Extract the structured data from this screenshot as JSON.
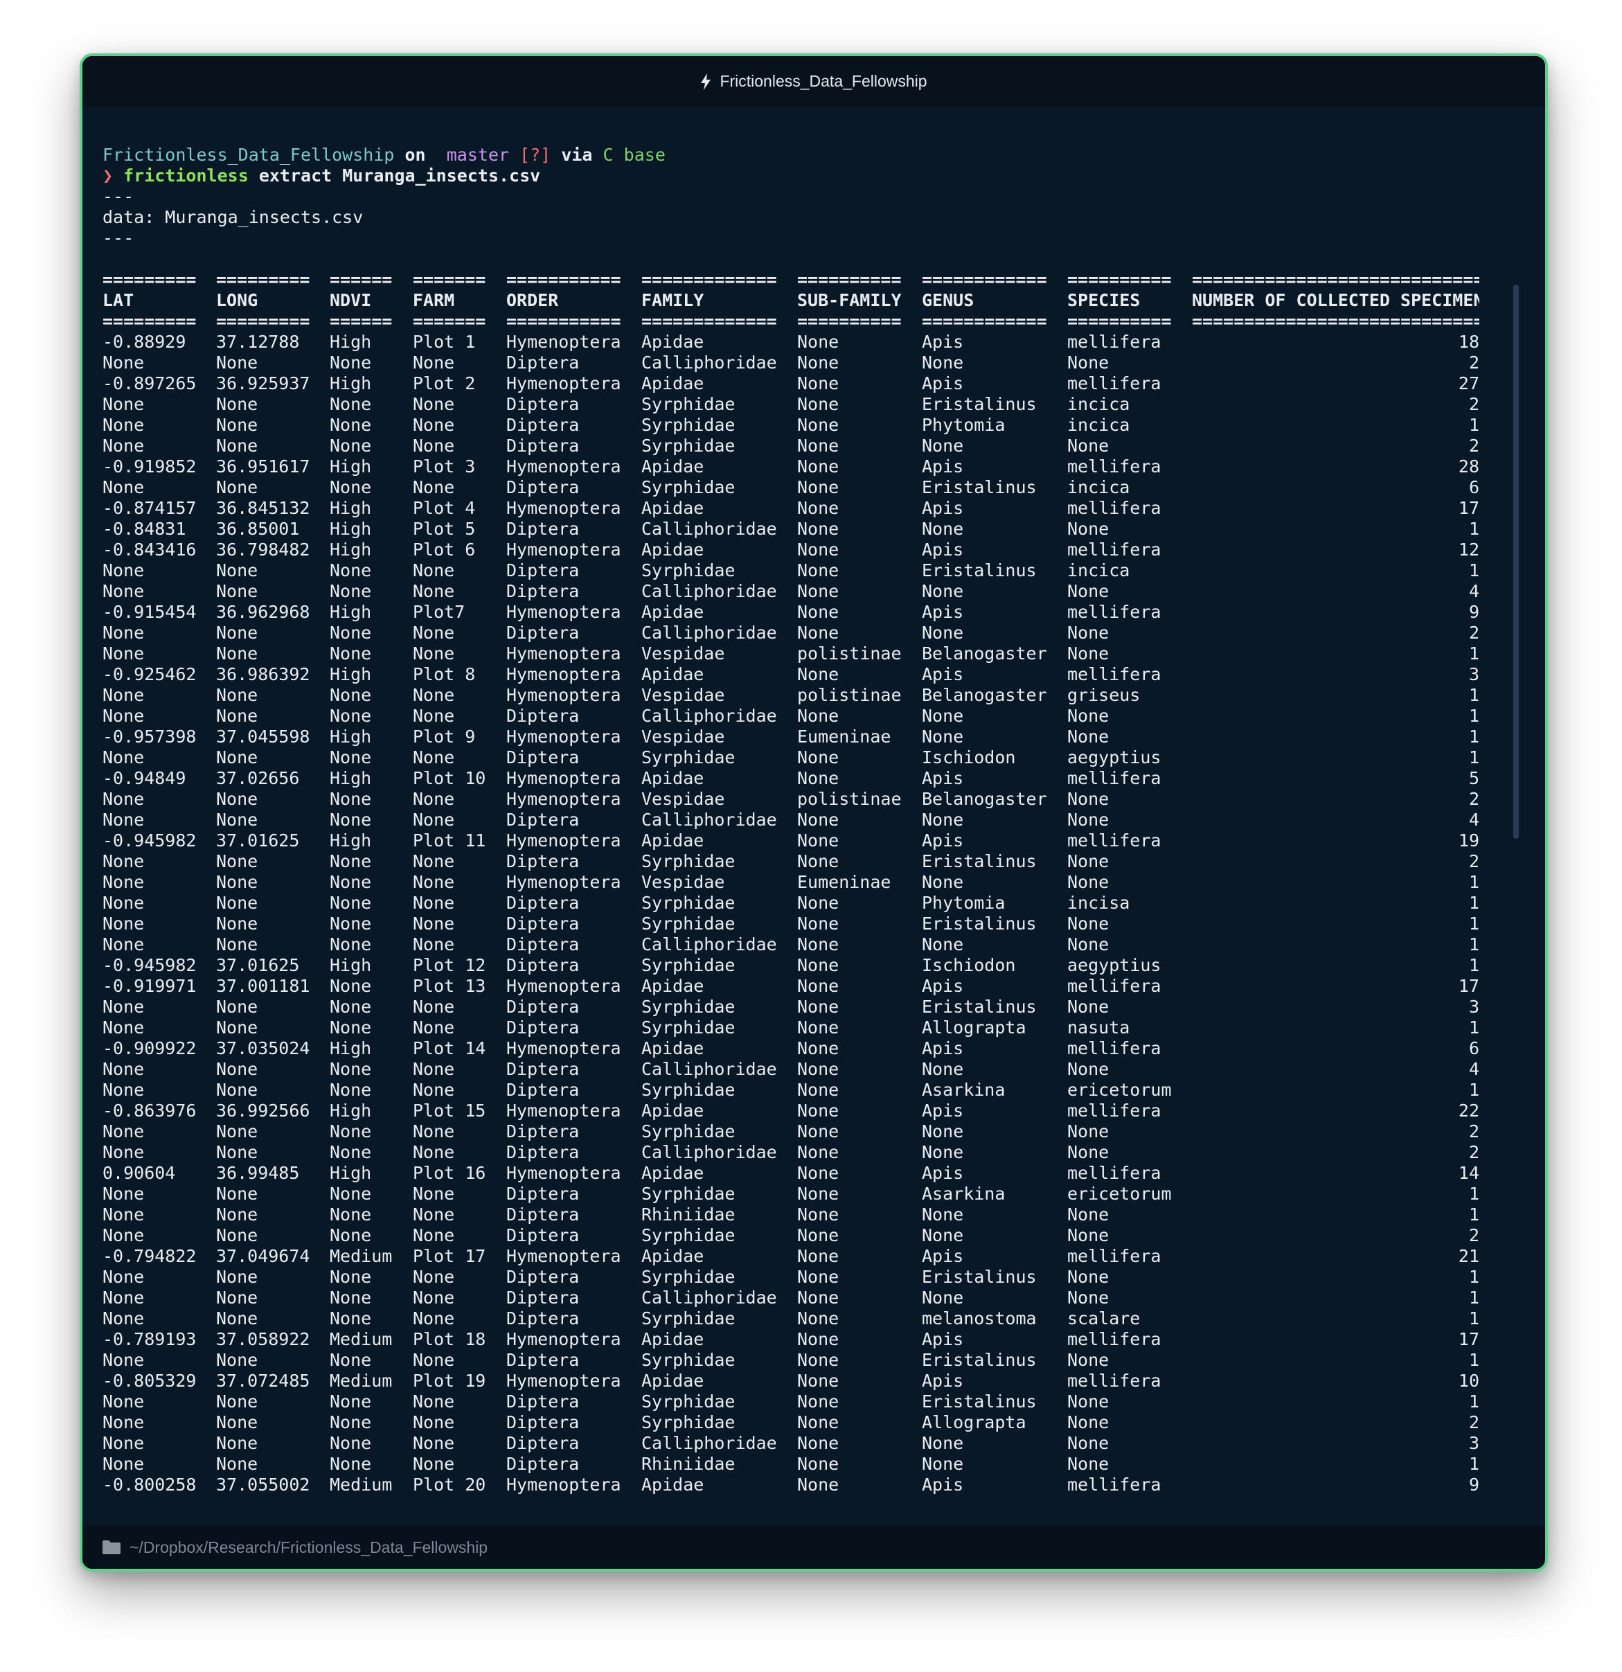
{
  "window": {
    "title": "Frictionless_Data_Fellowship"
  },
  "terminal": {
    "prompt_line": {
      "dir": "Frictionless_Data_Fellowship",
      "on": "on",
      "branch_icon": "",
      "branch": "master",
      "status": "[?]",
      "via": "via",
      "env_icon": "C",
      "env": "base"
    },
    "command_line": {
      "prompt_symbol": "❯",
      "command": "frictionless",
      "args": "extract Muranga_insects.csv"
    },
    "output_lines": [
      "---",
      "data: Muranga_insects.csv",
      "---"
    ]
  },
  "table": {
    "separators": [
      "=========",
      "=========",
      "======",
      "=======",
      "===========",
      "=============",
      "==========",
      "============",
      "==========",
      "============================"
    ],
    "headers": [
      "LAT",
      "LONG",
      "NDVI",
      "FARM",
      "ORDER",
      "FAMILY",
      "SUB-FAMILY",
      "GENUS",
      "SPECIES",
      "NUMBER OF COLLECTED SPECIMEN"
    ],
    "rows": [
      [
        "-0.88929",
        "37.12788",
        "High",
        "Plot 1",
        "Hymenoptera",
        "Apidae",
        "None",
        "Apis",
        "mellifera",
        "18"
      ],
      [
        "None",
        "None",
        "None",
        "None",
        "Diptera",
        "Calliphoridae",
        "None",
        "None",
        "None",
        "2"
      ],
      [
        "-0.897265",
        "36.925937",
        "High",
        "Plot 2",
        "Hymenoptera",
        "Apidae",
        "None",
        "Apis",
        "mellifera",
        "27"
      ],
      [
        "None",
        "None",
        "None",
        "None",
        "Diptera",
        "Syrphidae",
        "None",
        "Eristalinus",
        "incica",
        "2"
      ],
      [
        "None",
        "None",
        "None",
        "None",
        "Diptera",
        "Syrphidae",
        "None",
        "Phytomia",
        "incica",
        "1"
      ],
      [
        "None",
        "None",
        "None",
        "None",
        "Diptera",
        "Syrphidae",
        "None",
        "None",
        "None",
        "2"
      ],
      [
        "-0.919852",
        "36.951617",
        "High",
        "Plot 3",
        "Hymenoptera",
        "Apidae",
        "None",
        "Apis",
        "mellifera",
        "28"
      ],
      [
        "None",
        "None",
        "None",
        "None",
        "Diptera",
        "Syrphidae",
        "None",
        "Eristalinus",
        "incica",
        "6"
      ],
      [
        "-0.874157",
        "36.845132",
        "High",
        "Plot 4",
        "Hymenoptera",
        "Apidae",
        "None",
        "Apis",
        "mellifera",
        "17"
      ],
      [
        "-0.84831",
        "36.85001",
        "High",
        "Plot 5",
        "Diptera",
        "Calliphoridae",
        "None",
        "None",
        "None",
        "1"
      ],
      [
        "-0.843416",
        "36.798482",
        "High",
        "Plot 6",
        "Hymenoptera",
        "Apidae",
        "None",
        "Apis",
        "mellifera",
        "12"
      ],
      [
        "None",
        "None",
        "None",
        "None",
        "Diptera",
        "Syrphidae",
        "None",
        "Eristalinus",
        "incica",
        "1"
      ],
      [
        "None",
        "None",
        "None",
        "None",
        "Diptera",
        "Calliphoridae",
        "None",
        "None",
        "None",
        "4"
      ],
      [
        "-0.915454",
        "36.962968",
        "High",
        "Plot7",
        "Hymenoptera",
        "Apidae",
        "None",
        "Apis",
        "mellifera",
        "9"
      ],
      [
        "None",
        "None",
        "None",
        "None",
        "Diptera",
        "Calliphoridae",
        "None",
        "None",
        "None",
        "2"
      ],
      [
        "None",
        "None",
        "None",
        "None",
        "Hymenoptera",
        "Vespidae",
        "polistinae",
        "Belanogaster",
        "None",
        "1"
      ],
      [
        "-0.925462",
        "36.986392",
        "High",
        "Plot 8",
        "Hymenoptera",
        "Apidae",
        "None",
        "Apis",
        "mellifera",
        "3"
      ],
      [
        "None",
        "None",
        "None",
        "None",
        "Hymenoptera",
        "Vespidae",
        "polistinae",
        "Belanogaster",
        "griseus",
        "1"
      ],
      [
        "None",
        "None",
        "None",
        "None",
        "Diptera",
        "Calliphoridae",
        "None",
        "None",
        "None",
        "1"
      ],
      [
        "-0.957398",
        "37.045598",
        "High",
        "Plot 9",
        "Hymenoptera",
        "Vespidae",
        "Eumeninae",
        "None",
        "None",
        "1"
      ],
      [
        "None",
        "None",
        "None",
        "None",
        "Diptera",
        "Syrphidae",
        "None",
        "Ischiodon",
        "aegyptius",
        "1"
      ],
      [
        "-0.94849",
        "37.02656",
        "High",
        "Plot 10",
        "Hymenoptera",
        "Apidae",
        "None",
        "Apis",
        "mellifera",
        "5"
      ],
      [
        "None",
        "None",
        "None",
        "None",
        "Hymenoptera",
        "Vespidae",
        "polistinae",
        "Belanogaster",
        "None",
        "2"
      ],
      [
        "None",
        "None",
        "None",
        "None",
        "Diptera",
        "Calliphoridae",
        "None",
        "None",
        "None",
        "4"
      ],
      [
        "-0.945982",
        "37.01625",
        "High",
        "Plot 11",
        "Hymenoptera",
        "Apidae",
        "None",
        "Apis",
        "mellifera",
        "19"
      ],
      [
        "None",
        "None",
        "None",
        "None",
        "Diptera",
        "Syrphidae",
        "None",
        "Eristalinus",
        "None",
        "2"
      ],
      [
        "None",
        "None",
        "None",
        "None",
        "Hymenoptera",
        "Vespidae",
        "Eumeninae",
        "None",
        "None",
        "1"
      ],
      [
        "None",
        "None",
        "None",
        "None",
        "Diptera",
        "Syrphidae",
        "None",
        "Phytomia",
        "incisa",
        "1"
      ],
      [
        "None",
        "None",
        "None",
        "None",
        "Diptera",
        "Syrphidae",
        "None",
        "Eristalinus",
        "None",
        "1"
      ],
      [
        "None",
        "None",
        "None",
        "None",
        "Diptera",
        "Calliphoridae",
        "None",
        "None",
        "None",
        "1"
      ],
      [
        "-0.945982",
        "37.01625",
        "High",
        "Plot 12",
        "Diptera",
        "Syrphidae",
        "None",
        "Ischiodon",
        "aegyptius",
        "1"
      ],
      [
        "-0.919971",
        "37.001181",
        "None",
        "Plot 13",
        "Hymenoptera",
        "Apidae",
        "None",
        "Apis",
        "mellifera",
        "17"
      ],
      [
        "None",
        "None",
        "None",
        "None",
        "Diptera",
        "Syrphidae",
        "None",
        "Eristalinus",
        "None",
        "3"
      ],
      [
        "None",
        "None",
        "None",
        "None",
        "Diptera",
        "Syrphidae",
        "None",
        "Allograpta",
        "nasuta",
        "1"
      ],
      [
        "-0.909922",
        "37.035024",
        "High",
        "Plot 14",
        "Hymenoptera",
        "Apidae",
        "None",
        "Apis",
        "mellifera",
        "6"
      ],
      [
        "None",
        "None",
        "None",
        "None",
        "Diptera",
        "Calliphoridae",
        "None",
        "None",
        "None",
        "4"
      ],
      [
        "None",
        "None",
        "None",
        "None",
        "Diptera",
        "Syrphidae",
        "None",
        "Asarkina",
        "ericetorum",
        "1"
      ],
      [
        "-0.863976",
        "36.992566",
        "High",
        "Plot 15",
        "Hymenoptera",
        "Apidae",
        "None",
        "Apis",
        "mellifera",
        "22"
      ],
      [
        "None",
        "None",
        "None",
        "None",
        "Diptera",
        "Syrphidae",
        "None",
        "None",
        "None",
        "2"
      ],
      [
        "None",
        "None",
        "None",
        "None",
        "Diptera",
        "Calliphoridae",
        "None",
        "None",
        "None",
        "2"
      ],
      [
        "0.90604",
        "36.99485",
        "High",
        "Plot 16",
        "Hymenoptera",
        "Apidae",
        "None",
        "Apis",
        "mellifera",
        "14"
      ],
      [
        "None",
        "None",
        "None",
        "None",
        "Diptera",
        "Syrphidae",
        "None",
        "Asarkina",
        "ericetorum",
        "1"
      ],
      [
        "None",
        "None",
        "None",
        "None",
        "Diptera",
        "Rhiniidae",
        "None",
        "None",
        "None",
        "1"
      ],
      [
        "None",
        "None",
        "None",
        "None",
        "Diptera",
        "Syrphidae",
        "None",
        "None",
        "None",
        "2"
      ],
      [
        "-0.794822",
        "37.049674",
        "Medium",
        "Plot 17",
        "Hymenoptera",
        "Apidae",
        "None",
        "Apis",
        "mellifera",
        "21"
      ],
      [
        "None",
        "None",
        "None",
        "None",
        "Diptera",
        "Syrphidae",
        "None",
        "Eristalinus",
        "None",
        "1"
      ],
      [
        "None",
        "None",
        "None",
        "None",
        "Diptera",
        "Calliphoridae",
        "None",
        "None",
        "None",
        "1"
      ],
      [
        "None",
        "None",
        "None",
        "None",
        "Diptera",
        "Syrphidae",
        "None",
        "melanostoma",
        "scalare",
        "1"
      ],
      [
        "-0.789193",
        "37.058922",
        "Medium",
        "Plot 18",
        "Hymenoptera",
        "Apidae",
        "None",
        "Apis",
        "mellifera",
        "17"
      ],
      [
        "None",
        "None",
        "None",
        "None",
        "Diptera",
        "Syrphidae",
        "None",
        "Eristalinus",
        "None",
        "1"
      ],
      [
        "-0.805329",
        "37.072485",
        "Medium",
        "Plot 19",
        "Hymenoptera",
        "Apidae",
        "None",
        "Apis",
        "mellifera",
        "10"
      ],
      [
        "None",
        "None",
        "None",
        "None",
        "Diptera",
        "Syrphidae",
        "None",
        "Eristalinus",
        "None",
        "1"
      ],
      [
        "None",
        "None",
        "None",
        "None",
        "Diptera",
        "Syrphidae",
        "None",
        "Allograpta",
        "None",
        "2"
      ],
      [
        "None",
        "None",
        "None",
        "None",
        "Diptera",
        "Calliphoridae",
        "None",
        "None",
        "None",
        "3"
      ],
      [
        "None",
        "None",
        "None",
        "None",
        "Diptera",
        "Rhiniidae",
        "None",
        "None",
        "None",
        "1"
      ],
      [
        "-0.800258",
        "37.055002",
        "Medium",
        "Plot 20",
        "Hymenoptera",
        "Apidae",
        "None",
        "Apis",
        "mellifera",
        "9"
      ]
    ]
  },
  "statusbar": {
    "icon": "folder-icon",
    "path": "~/Dropbox/Research/Frictionless_Data_Fellowship"
  },
  "colors": {
    "window_bg": "#081827",
    "window_border": "#5fd18f",
    "dir": "#7fc7c3",
    "branch": "#c792ea",
    "status": "#ef6b73",
    "env": "#7fd36b",
    "command": "#8ee05a"
  }
}
